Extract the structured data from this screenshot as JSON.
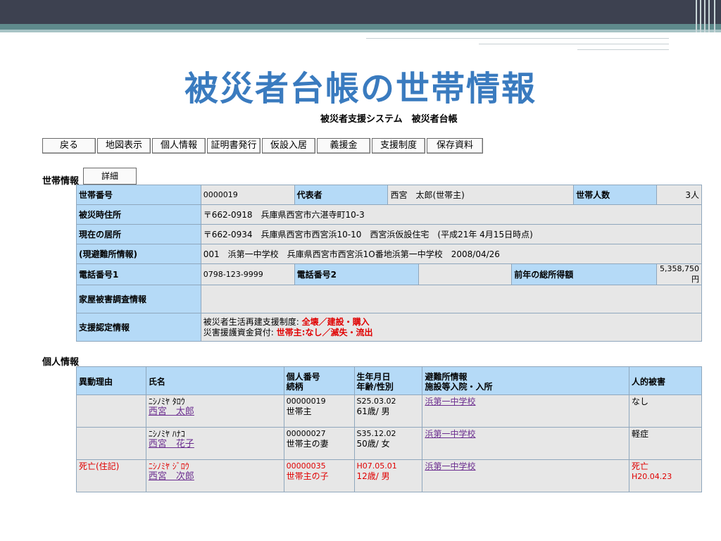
{
  "slide_title": "被災者台帳の世帯情報",
  "system_title": "被災者支援システム　被災者台帳",
  "buttons": [
    "戻る",
    "地図表示",
    "個人情報",
    "証明書発行",
    "仮設入居",
    "義援金",
    "支援制度",
    "保存資料"
  ],
  "household": {
    "section_label": "世帯情報",
    "detail_button": "詳細",
    "labels": {
      "household_no": "世帯番号",
      "representative": "代表者",
      "household_count": "世帯人数",
      "address_at_disaster": "被災時住所",
      "current_residence": "現在の居所",
      "evacuation_info": "(現避難所情報)",
      "phone1": "電話番号1",
      "phone2": "電話番号2",
      "income": "前年の総所得額",
      "house_damage": "家屋被害調査情報",
      "support": "支援認定情報"
    },
    "values": {
      "household_no": "0000019",
      "representative": "西宮　太郎(世帯主)",
      "household_count": "3人",
      "address_at_disaster": "〒662-0918　兵庫県西宮市六湛寺町10-3",
      "current_residence": "〒662-0934　兵庫県西宮市西宮浜10-10　西宮浜仮設住宅　(平成21年 4月15日時点)",
      "evacuation_info": "001　浜第一中学校　兵庫県西宮市西宮浜1O番地浜第一中学校　2008/04/26",
      "phone1": "0798-123-9999",
      "phone2": "",
      "income": "5,358,750円",
      "house_damage": "",
      "support_line1_label": "被災者生活再建支援制度:",
      "support_line1_value": "全壊／建設・購入",
      "support_line2_label": "災害援護資金貸付:",
      "support_line2_value": "世帯主:なし／滅失・流出"
    }
  },
  "persons": {
    "section_label": "個人情報",
    "headers": {
      "reason": "異動理由",
      "name": "氏名",
      "id1": "個人番号",
      "id2": "続柄",
      "birth1": "生年月日",
      "birth2": "年齢/性別",
      "shelter1": "避難所情報",
      "shelter2": "施設等入院・入所",
      "damage": "人的被害"
    },
    "rows": [
      {
        "reason": "",
        "kana": "ﾆｼﾉﾐﾔ ﾀﾛｳ",
        "name": "西宮　太郎",
        "id": "00000019",
        "relation": "世帯主",
        "birth": "S25.03.02",
        "age_sex": "61歳/ 男",
        "shelter": "浜第一中学校",
        "damage": "なし",
        "damage_date": ""
      },
      {
        "reason": "",
        "kana": "ﾆｼﾉﾐﾔ ﾊﾅｺ",
        "name": "西宮　花子",
        "id": "00000027",
        "relation": "世帯主の妻",
        "birth": "S35.12.02",
        "age_sex": "50歳/ 女",
        "shelter": "浜第一中学校",
        "damage": "軽症",
        "damage_date": ""
      },
      {
        "reason": "死亡(住記)",
        "kana": "ﾆｼﾉﾐﾔ ｼﾞﾛｳ",
        "name": "西宮　次郎",
        "id": "00000035",
        "relation": "世帯主の子",
        "birth": "H07.05.01",
        "age_sex": "12歳/ 男",
        "shelter": "浜第一中学校",
        "damage": "死亡",
        "damage_date": "H20.04.23"
      }
    ]
  },
  "colors": {
    "header_bg": "#b5daf7",
    "value_bg": "#e7e7e7",
    "title": "#3a7bbf",
    "alert": "#e00000",
    "link": "#6b2d8f",
    "top_bar": "#3d4150",
    "accent_bar": "#5f8a8c"
  }
}
